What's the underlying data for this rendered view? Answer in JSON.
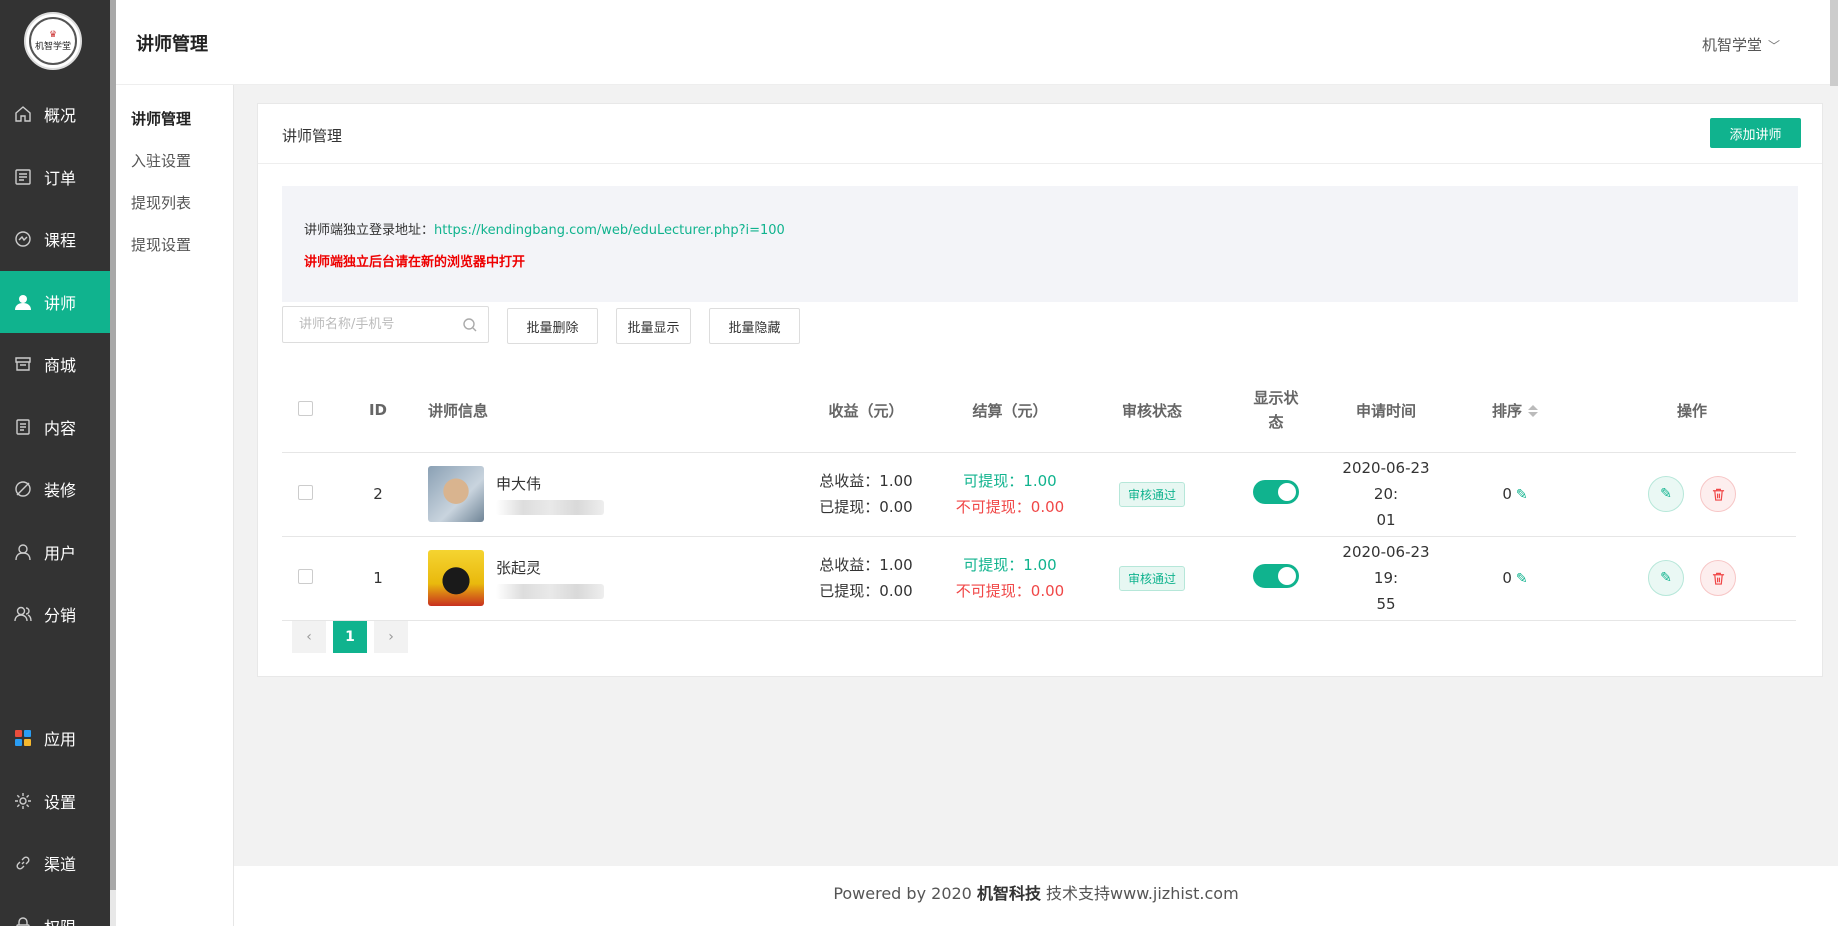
{
  "logo": {
    "text": "机智学堂",
    "crown": "♛"
  },
  "sidebar": {
    "items": [
      {
        "label": "概况",
        "icon": "home-icon"
      },
      {
        "label": "订单",
        "icon": "order-icon"
      },
      {
        "label": "课程",
        "icon": "course-icon"
      },
      {
        "label": "讲师",
        "icon": "lecturer-icon",
        "active": true
      },
      {
        "label": "商城",
        "icon": "shop-icon"
      },
      {
        "label": "内容",
        "icon": "content-icon"
      },
      {
        "label": "装修",
        "icon": "decor-icon"
      },
      {
        "label": "用户",
        "icon": "user-icon"
      },
      {
        "label": "分销",
        "icon": "distribution-icon"
      }
    ],
    "bottom_items": [
      {
        "label": "应用",
        "icon": "apps-icon"
      },
      {
        "label": "设置",
        "icon": "gear-icon"
      },
      {
        "label": "渠道",
        "icon": "link-icon"
      },
      {
        "label": "权限",
        "icon": "lock-icon"
      }
    ]
  },
  "header": {
    "title": "讲师管理",
    "user": "机智学堂"
  },
  "subnav": {
    "items": [
      {
        "label": "讲师管理",
        "active": true
      },
      {
        "label": "入驻设置"
      },
      {
        "label": "提现列表"
      },
      {
        "label": "提现设置"
      }
    ]
  },
  "card": {
    "title": "讲师管理",
    "add_label": "添加讲师",
    "notice_prefix": "讲师端独立登录地址：",
    "notice_url": "https://kendingbang.com/web/eduLecturer.php?i=100",
    "notice_warning": "讲师端独立后台请在新的浏览器中打开"
  },
  "toolbar": {
    "search_placeholder": "讲师名称/手机号",
    "batch_delete": "批量删除",
    "batch_show": "批量显示",
    "batch_hide": "批量隐藏"
  },
  "table": {
    "headers": {
      "id": "ID",
      "info": "讲师信息",
      "income": "收益（元）",
      "settle": "结算（元）",
      "audit": "审核状态",
      "display": "显示状\n态",
      "apply_time": "申请时间",
      "sort": "排序",
      "ops": "操作"
    },
    "rows": [
      {
        "id": "2",
        "name": "申大伟",
        "total_income": "总收益：1.00",
        "withdrawn": "已提现：0.00",
        "can_withdraw": "可提现：1.00",
        "cannot_withdraw": "不可提现：0.00",
        "audit": "审核通过",
        "date1": "2020-06-23 20:",
        "date2": "01",
        "sort": "0"
      },
      {
        "id": "1",
        "name": "张起灵",
        "total_income": "总收益：1.00",
        "withdrawn": "已提现：0.00",
        "can_withdraw": "可提现：1.00",
        "cannot_withdraw": "不可提现：0.00",
        "audit": "审核通过",
        "date1": "2020-06-23 19:",
        "date2": "55",
        "sort": "0"
      }
    ]
  },
  "pager": {
    "prev": "‹",
    "current": "1",
    "next": "›"
  },
  "footer": {
    "prefix": "Powered by 2020 ",
    "brand": "机智科技",
    "suffix": " 技术支持www.jizhist.com"
  },
  "colors": {
    "accent": "#10b38e",
    "sidebar": "#333333",
    "danger": "#f04747"
  }
}
